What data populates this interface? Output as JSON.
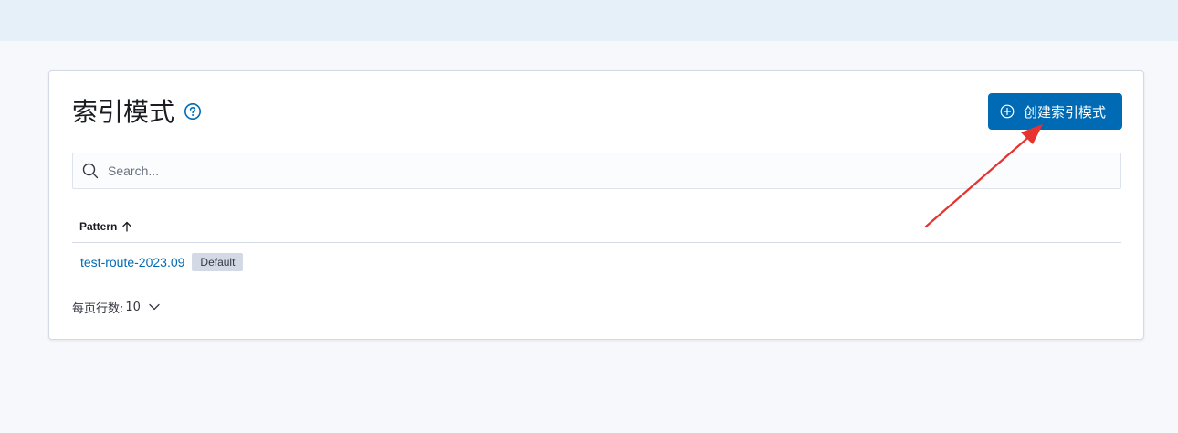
{
  "page": {
    "title": "索引模式"
  },
  "toolbar": {
    "create_label": "创建索引模式"
  },
  "search": {
    "placeholder": "Search..."
  },
  "table": {
    "columns": [
      "Pattern"
    ],
    "rows": [
      {
        "pattern": "test-route-2023.09",
        "badge": "Default"
      }
    ]
  },
  "pagination": {
    "rows_per_page_label": "每页行数:",
    "rows_per_page_value": "10"
  },
  "colors": {
    "accent": "#006bb4",
    "annotation": "#e8322f"
  },
  "icons": [
    "question-circle-icon",
    "plus-circle-icon",
    "search-icon",
    "sort-up-arrow-icon",
    "chevron-down-icon"
  ]
}
